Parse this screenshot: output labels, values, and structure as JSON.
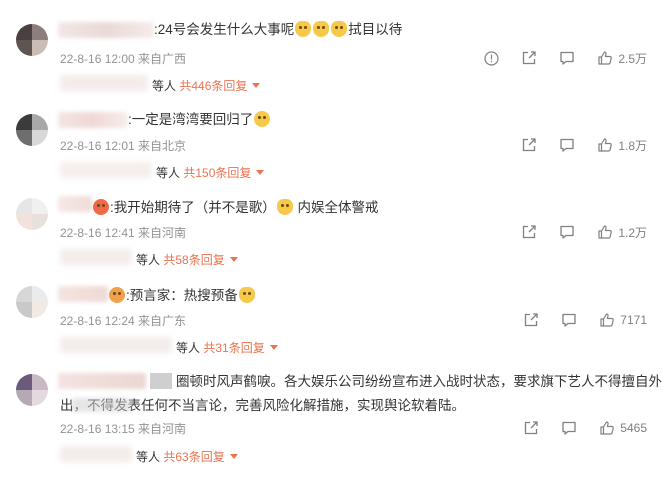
{
  "colors": {
    "accent": "#eb7350",
    "meta": "#939393",
    "text": "#333333"
  },
  "comments": [
    {
      "text_before": ":24号会发生什么大事呢",
      "emojis": 3,
      "text_after": "拭目以待",
      "meta": "22-8-16 12:00 来自广西",
      "reply_who": "等人",
      "reply_count": "共446条回复",
      "likes": "2.5万",
      "has_report": true
    },
    {
      "text_before": ":一定是湾湾要回归了",
      "emojis": 1,
      "text_after": "",
      "meta": "22-8-16 12:01 来自北京",
      "reply_who": "等人",
      "reply_count": "共150条回复",
      "likes": "1.8万",
      "has_report": false
    },
    {
      "text_before": ":我开始期待了（并不是歌）",
      "emojis": 1,
      "text_after": "内娱全体警戒",
      "meta": "22-8-16 12:41 来自河南",
      "reply_who": "等人",
      "reply_count": "共58条回复",
      "likes": "1.2万",
      "has_report": false
    },
    {
      "text_before": ":预言家：热搜预备",
      "emojis": 1,
      "text_after": "",
      "meta": "22-8-16 12:24 来自广东",
      "reply_who": "等人",
      "reply_count": "共31条回复",
      "likes": "7171",
      "has_report": false
    },
    {
      "line1": "圈顿时风声鹤唳。各大娱乐公司纷纷宣布进入战时状态，要求旗下艺人不得擅自外",
      "line2": "出，不得发表任何不当言论，完善风险化解措施，实现舆论软着陆。",
      "meta": "22-8-16 13:15 来自河南",
      "reply_who": "等人",
      "reply_count": "共63条回复",
      "likes": "5465",
      "has_report": false
    }
  ],
  "icons": {
    "report": "report-icon",
    "share": "share-icon",
    "comment": "comment-icon",
    "like": "like-icon"
  }
}
